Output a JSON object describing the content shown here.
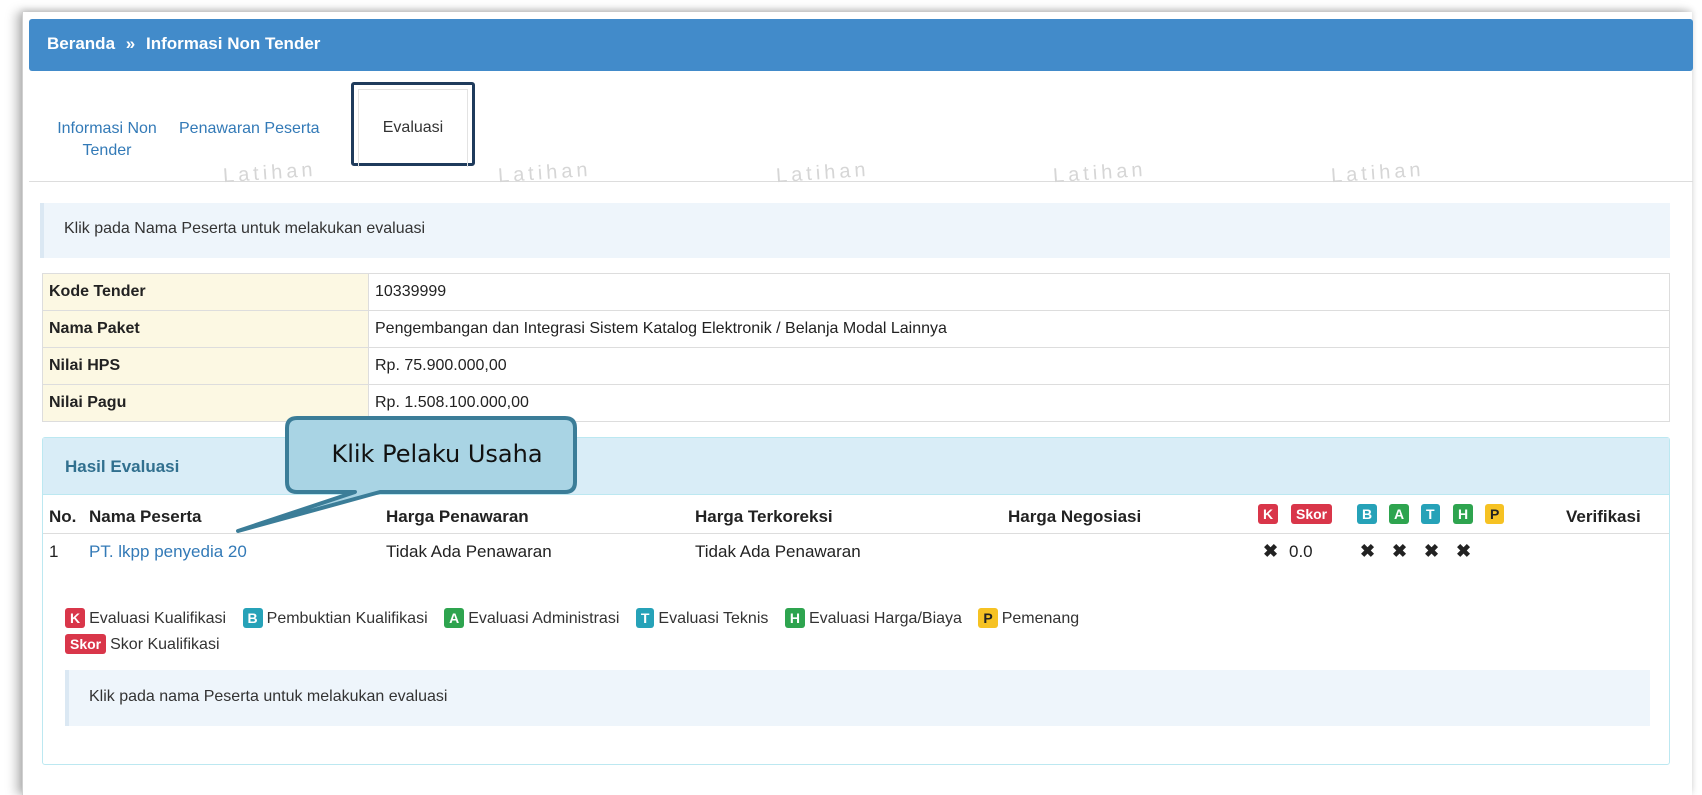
{
  "breadcrumb": {
    "home": "Beranda",
    "separator": "»",
    "current": "Informasi Non Tender"
  },
  "tabs": [
    {
      "label": "Informasi Non Tender"
    },
    {
      "label": "Penawaran Peserta"
    },
    {
      "label": "Evaluasi"
    }
  ],
  "watermark_text": "Latihan",
  "info_message": "Klik pada Nama Peserta untuk melakukan evaluasi",
  "detail": [
    {
      "key": "Kode Tender",
      "value": "10339999"
    },
    {
      "key": "Nama Paket",
      "value": "Pengembangan dan Integrasi Sistem Katalog Elektronik / Belanja Modal Lainnya"
    },
    {
      "key": "Nilai HPS",
      "value": "Rp. 75.900.000,00"
    },
    {
      "key": "Nilai Pagu",
      "value": "Rp. 1.508.100.000,00"
    }
  ],
  "hasil_evaluasi": {
    "title": "Hasil Evaluasi",
    "columns": {
      "no": "No.",
      "nama": "Nama Peserta",
      "harga": "Harga Penawaran",
      "terkoreksi": "Harga Terkoreksi",
      "negosiasi": "Harga Negosiasi",
      "verifikasi": "Verifikasi"
    },
    "badges": {
      "k": "K",
      "skor": "Skor",
      "b": "B",
      "a": "A",
      "t": "T",
      "h": "H",
      "p": "P"
    },
    "rows": [
      {
        "no": "1",
        "nama": "PT. lkpp penyedia 20",
        "harga": "Tidak Ada Penawaran",
        "terkoreksi": "Tidak Ada Penawaran",
        "k": "✖",
        "skor": "0.0",
        "b": "✖",
        "a": "✖",
        "t": "✖",
        "h": "✖"
      }
    ],
    "legend": {
      "k": "Evaluasi Kualifikasi",
      "b": "Pembuktian Kualifikasi",
      "a": "Evaluasi Administrasi",
      "t": "Evaluasi Teknis",
      "h": "Evaluasi Harga/Biaya",
      "p": "Pemenang",
      "skor": "Skor Kualifikasi"
    },
    "hint": "Klik pada nama Peserta untuk melakukan evaluasi"
  },
  "callout": {
    "text": "Klik Pelaku Usaha"
  },
  "colors": {
    "header": "#428bca",
    "link": "#337ab7",
    "badge_red": "#d9364a",
    "badge_blue": "#26a2b8",
    "badge_green": "#2ea44f",
    "badge_yellow": "#f6c223",
    "callout_fill": "#a9d4e4",
    "callout_border": "#3b7d98"
  }
}
